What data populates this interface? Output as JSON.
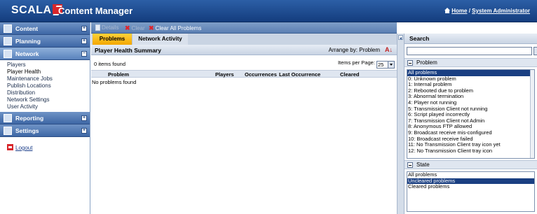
{
  "header": {
    "brand": "SCALA",
    "app_title": "Content Manager",
    "home_link": "Home",
    "separator": "/",
    "user_link": "System Administrator"
  },
  "sidebar": {
    "sections": [
      {
        "label": "Content",
        "icon": "folder-icon"
      },
      {
        "label": "Planning",
        "icon": "calendar-icon"
      },
      {
        "label": "Network",
        "icon": "network-icon"
      },
      {
        "label": "Reporting",
        "icon": "report-icon"
      },
      {
        "label": "Settings",
        "icon": "settings-icon"
      }
    ],
    "network_items": [
      "Players",
      "Player Health",
      "Maintenance Jobs",
      "Publish Locations",
      "Distribution",
      "Network Settings",
      "User Activity"
    ],
    "logout": "Logout"
  },
  "toolbar": {
    "details": "Details",
    "clear": "Clear",
    "clear_all": "Clear All Problems"
  },
  "tabs": [
    "Problems",
    "Network Activity"
  ],
  "main": {
    "title": "Player Health Summary",
    "arrange_by": "Arrange by: Problem",
    "items_found": "0 items found",
    "items_per_page_label": "Items per Page:",
    "items_per_page_value": "25",
    "columns": [
      "Problem",
      "Players",
      "Occurrences",
      "Last Occurrence",
      "Cleared"
    ],
    "empty_message": "No problems found"
  },
  "search": {
    "title": "Search",
    "input_value": "",
    "problem_header": "Problem",
    "problem_options": [
      "All problems",
      "0: Unknown problem",
      "1: Internal problem",
      "2: Rebooted due to problem",
      "3: Abnormal termination",
      "4: Player not running",
      "5: Transmission Client not running",
      "6: Script played incorrectly",
      "7: Transmission Client not Admin",
      "8: Anonymous FTP allowed",
      "9: Broadcast receive mis-configured",
      "10: Broadcast receive failed",
      "11: No Transmission Client tray icon yet",
      "12: No Transmission Client tray icon"
    ],
    "problem_selected": "All problems",
    "state_header": "State",
    "state_options": [
      "All problems",
      "Uncleared problems",
      "Cleared problems"
    ],
    "state_selected": "Uncleared problems"
  },
  "colors": {
    "header_bg": "#1f4f95",
    "nav_bg": "#4a72ad",
    "active_tab": "#f7b500",
    "selection": "#1a3f82",
    "brand_red": "#d8262b"
  }
}
